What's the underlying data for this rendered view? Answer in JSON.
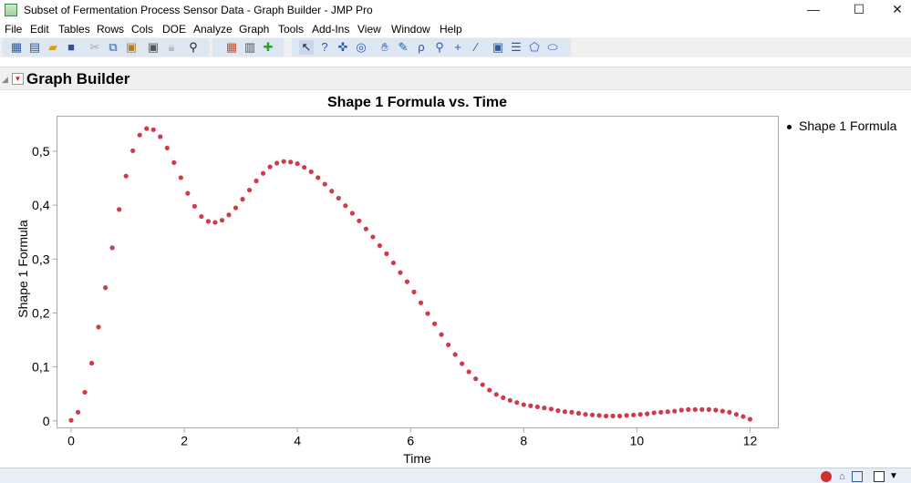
{
  "window": {
    "title": "Subset of Fermentation Process Sensor Data - Graph Builder - JMP Pro",
    "minimize": "—",
    "maximize": "☐",
    "close": "✕"
  },
  "menu": [
    "File",
    "Edit",
    "Tables",
    "Rows",
    "Cols",
    "DOE",
    "Analyze",
    "Graph",
    "Tools",
    "Add-Ins",
    "View",
    "Window",
    "Help"
  ],
  "toolbar_icons": [
    "new-data-table-icon",
    "new-script-icon",
    "open-icon",
    "save-icon",
    "cut-icon",
    "copy-icon",
    "paste-icon",
    "journal-icon",
    "lock-icon",
    "search-icon",
    "data-table-icon",
    "distribution-icon",
    "add-graph-icon",
    "arrow-tool-icon",
    "help-tool-icon",
    "selection-tool-icon",
    "crosshair-icon",
    "hand-tool-icon",
    "brush-icon",
    "lasso-icon",
    "magnifier-icon",
    "plus-tool-icon",
    "line-tool-icon",
    "annotate-icon",
    "simple-shape-icon",
    "polygon-icon",
    "oval-icon"
  ],
  "outline": {
    "title": "Graph Builder"
  },
  "chart_data": {
    "type": "scatter",
    "title": "Shape 1 Formula vs. Time",
    "xlabel": "Time",
    "ylabel": "Shape 1 Formula",
    "xlim": [
      -0.25,
      12.5
    ],
    "ylim": [
      -0.013,
      0.565
    ],
    "x_ticks": [
      0,
      2,
      4,
      6,
      8,
      10,
      12
    ],
    "x_tick_labels": [
      "0",
      "2",
      "4",
      "6",
      "8",
      "10",
      "12"
    ],
    "y_ticks": [
      0,
      0.1,
      0.2,
      0.3,
      0.4,
      0.5
    ],
    "y_tick_labels": [
      "0",
      "0,1",
      "0,2",
      "0,3",
      "0,4",
      "0,5"
    ],
    "legend": {
      "placement": "right",
      "entries": [
        "Shape 1 Formula"
      ]
    },
    "series": [
      {
        "name": "Shape 1 Formula",
        "color": "#d03a4a",
        "x_min": 0,
        "x_max": 12,
        "y": [
          0.001,
          0.016,
          0.053,
          0.107,
          0.174,
          0.247,
          0.321,
          0.392,
          0.454,
          0.501,
          0.53,
          0.542,
          0.54,
          0.527,
          0.506,
          0.479,
          0.451,
          0.422,
          0.398,
          0.379,
          0.37,
          0.368,
          0.372,
          0.382,
          0.395,
          0.411,
          0.428,
          0.445,
          0.459,
          0.471,
          0.478,
          0.481,
          0.48,
          0.477,
          0.47,
          0.462,
          0.451,
          0.439,
          0.426,
          0.413,
          0.399,
          0.385,
          0.371,
          0.356,
          0.341,
          0.325,
          0.31,
          0.293,
          0.275,
          0.258,
          0.239,
          0.219,
          0.199,
          0.18,
          0.16,
          0.141,
          0.123,
          0.106,
          0.091,
          0.078,
          0.067,
          0.057,
          0.049,
          0.043,
          0.038,
          0.034,
          0.03,
          0.028,
          0.026,
          0.024,
          0.022,
          0.019,
          0.017,
          0.016,
          0.014,
          0.012,
          0.011,
          0.01,
          0.009,
          0.009,
          0.009,
          0.01,
          0.011,
          0.012,
          0.013,
          0.015,
          0.016,
          0.017,
          0.018,
          0.02,
          0.021,
          0.021,
          0.021,
          0.021,
          0.02,
          0.018,
          0.016,
          0.012,
          0.008,
          0.003
        ]
      }
    ]
  }
}
